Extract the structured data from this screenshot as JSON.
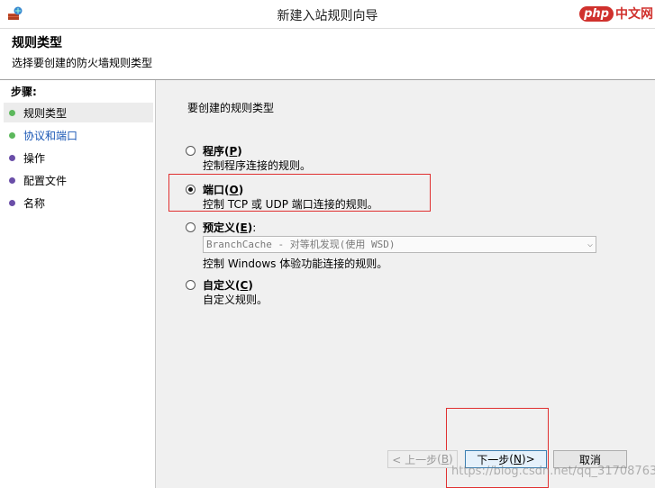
{
  "window": {
    "title": "新建入站规则向导",
    "icon": "firewall-wizard-icon"
  },
  "watermark": {
    "logo_php": "php",
    "logo_cn": "中文网",
    "url": "https://blog.csdn.net/qq_31708763"
  },
  "header": {
    "title": "规则类型",
    "subtitle": "选择要创建的防火墙规则类型"
  },
  "sidebar": {
    "steps_label": "步骤:",
    "items": [
      {
        "label": "规则类型",
        "color": "#5cb85c",
        "active": true
      },
      {
        "label": "协议和端口",
        "color": "#5cb85c",
        "link": true
      },
      {
        "label": "操作",
        "color": "#6a4ea8"
      },
      {
        "label": "配置文件",
        "color": "#6a4ea8"
      },
      {
        "label": "名称",
        "color": "#6a4ea8"
      }
    ]
  },
  "content": {
    "prompt": "要创建的规则类型",
    "options": [
      {
        "label": "程序",
        "key": "P",
        "desc": "控制程序连接的规则。",
        "selected": false
      },
      {
        "label": "端口",
        "key": "O",
        "desc": "控制 TCP 或 UDP 端口连接的规则。",
        "selected": true
      },
      {
        "label": "预定义",
        "key": "E",
        "suffix": ":",
        "desc": "控制 Windows 体验功能连接的规则。",
        "selected": false
      },
      {
        "label": "自定义",
        "key": "C",
        "desc": "自定义规则。",
        "selected": false
      }
    ],
    "predefined_select_value": "BranchCache - 对等机发现(使用 WSD)"
  },
  "buttons": {
    "back": {
      "label": "< 上一步",
      "key": "B"
    },
    "next": {
      "label": "下一步",
      "key": "N",
      "suffix": " >"
    },
    "cancel": {
      "label": "取消"
    }
  },
  "colors": {
    "highlight_red": "#e03030",
    "accent_blue": "#1a57b5"
  }
}
